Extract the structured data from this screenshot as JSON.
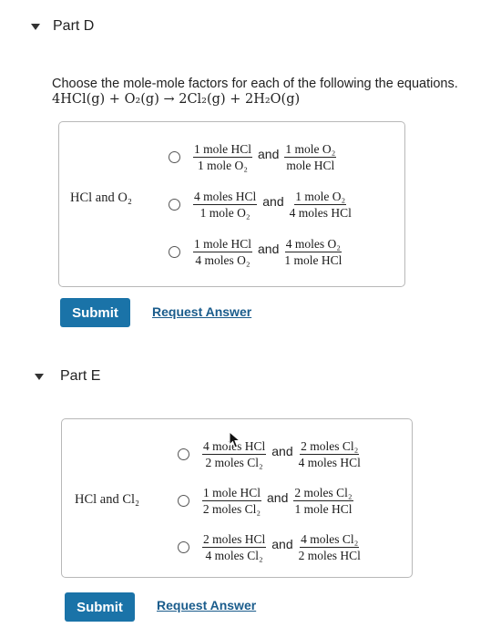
{
  "part_d": {
    "title": "Part D",
    "instructions": "Choose the mole-mole factors for each of the following the equations.",
    "equation": "4HCl(g) + O₂(g) → 2Cl₂(g) + 2H₂O(g)",
    "pair_label": "HCl and O₂",
    "options": [
      {
        "left_num": "1 mole HCl",
        "left_den": "1 mole O₂",
        "and": "and",
        "right_num": "1 mole O₂",
        "right_den": "mole HCl"
      },
      {
        "left_num": "4 moles HCl",
        "left_den": "1 mole O₂",
        "and": "and",
        "right_num": "1 mole O₂",
        "right_den": "4 moles HCl"
      },
      {
        "left_num": "1 mole HCl",
        "left_den": "4 moles O₂",
        "and": "and",
        "right_num": "4 moles O₂",
        "right_den": "1 mole HCl"
      }
    ],
    "submit_label": "Submit",
    "request_label": "Request Answer"
  },
  "part_e": {
    "title": "Part E",
    "pair_label": "HCl and Cl₂",
    "options": [
      {
        "left_num": "4 moles HCl",
        "left_den": "2 moles Cl₂",
        "and": "and",
        "right_num": "2 moles Cl₂",
        "right_den": "4 moles HCl"
      },
      {
        "left_num": "1 mole HCl",
        "left_den": "2 moles Cl₂",
        "and": "and",
        "right_num": "2 moles Cl₂",
        "right_den": "1 mole HCl"
      },
      {
        "left_num": "2 moles HCl",
        "left_den": "4 moles Cl₂",
        "and": "and",
        "right_num": "4 moles Cl₂",
        "right_den": "2 moles HCl"
      }
    ],
    "submit_label": "Submit",
    "request_label": "Request Answer"
  },
  "colors": {
    "button": "#1a73a8",
    "link": "#1a5c8c",
    "border": "#b8b8b8"
  },
  "icons": {
    "collapse": "caret-down-icon",
    "cursor": "mouse-pointer-icon"
  }
}
